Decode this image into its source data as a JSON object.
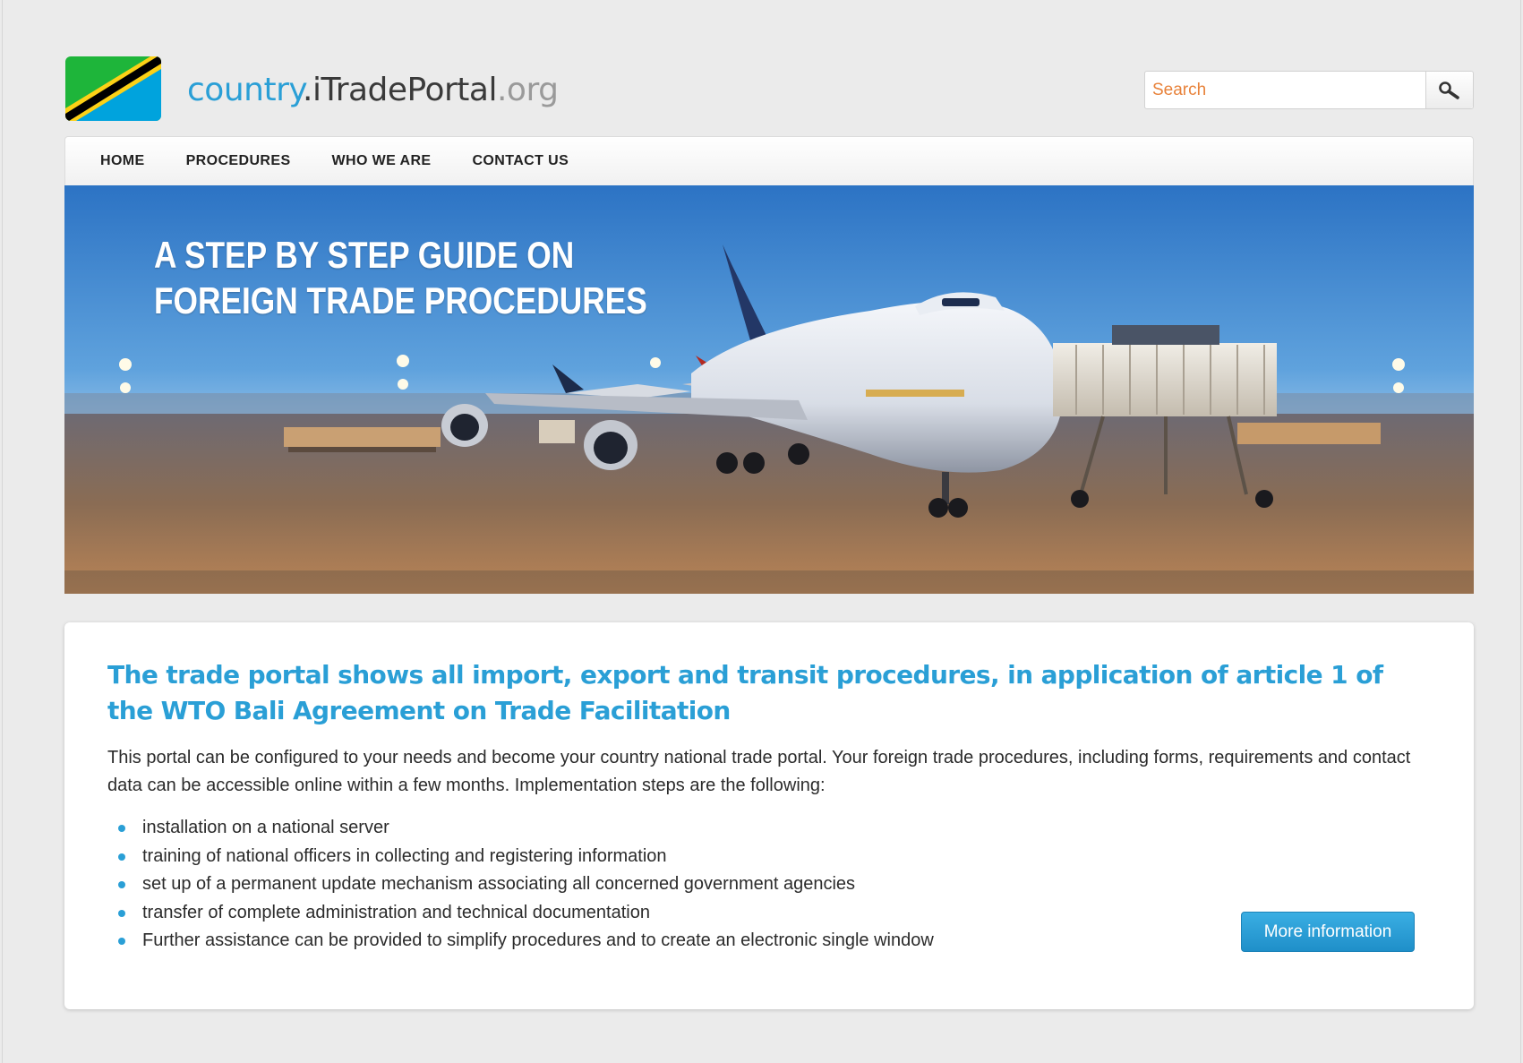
{
  "header": {
    "logo_icon": "tanzania-flag-icon",
    "title_part1": "country",
    "title_part2": ".iTradePortal",
    "title_part3": ".org",
    "search_placeholder": "Search",
    "search_icon": "search-icon"
  },
  "nav": {
    "items": [
      {
        "label": "HOME"
      },
      {
        "label": "PROCEDURES"
      },
      {
        "label": "WHO WE ARE"
      },
      {
        "label": "CONTACT US"
      }
    ]
  },
  "hero": {
    "line1": "A STEP BY STEP GUIDE ON",
    "line2": "FOREIGN TRADE PROCEDURES"
  },
  "main": {
    "heading": "The trade portal shows all import, export and transit procedures, in application of article 1 of the WTO Bali Agreement on Trade Facilitation",
    "intro": "This portal can be configured to your needs and become your country national trade portal. Your foreign trade procedures, including forms, requirements and contact data can be accessible online within a few months. Implementation steps are the following:",
    "steps": [
      "installation on a national server",
      "training of national officers in collecting and registering information",
      "set up of a permanent update mechanism associating all concerned government agencies",
      "transfer of complete administration and technical documentation",
      "Further assistance can be provided to simplify procedures and to create an electronic single window"
    ],
    "more_button": "More information"
  },
  "colors": {
    "accent": "#2a9fd6",
    "search_placeholder": "#e8823a",
    "page_bg": "#ebebeb"
  }
}
